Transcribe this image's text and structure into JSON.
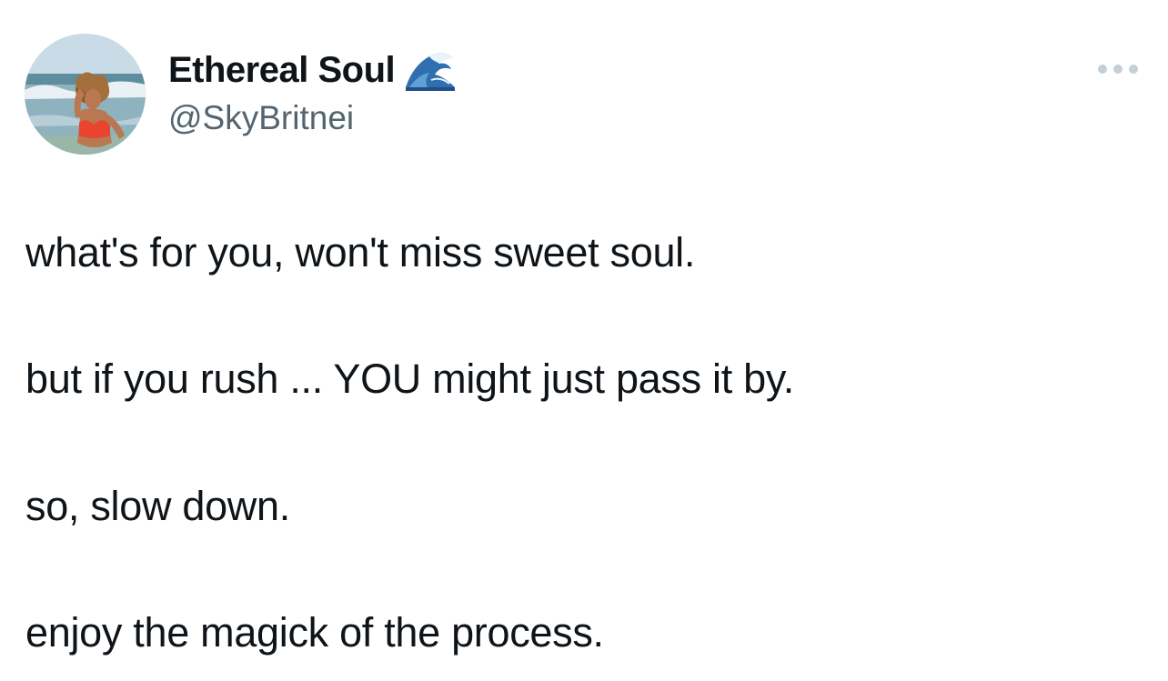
{
  "author": {
    "display_name": "Ethereal Soul",
    "name_emoji": "water-wave-emoji",
    "handle": "@SkyBritnei",
    "avatar": "profile-photo-woman-at-beach"
  },
  "menu": {
    "icon": "more-horizontal-icon"
  },
  "tweet": {
    "lines": [
      "what's for you, won't miss sweet soul.",
      "but if you rush ... YOU might just pass it by.",
      "so, slow down.",
      "enjoy the magick of the process."
    ]
  },
  "colors": {
    "text_primary": "#0f1419",
    "text_secondary": "#536471",
    "menu_dots": "#c4cfd6",
    "background": "#ffffff"
  }
}
